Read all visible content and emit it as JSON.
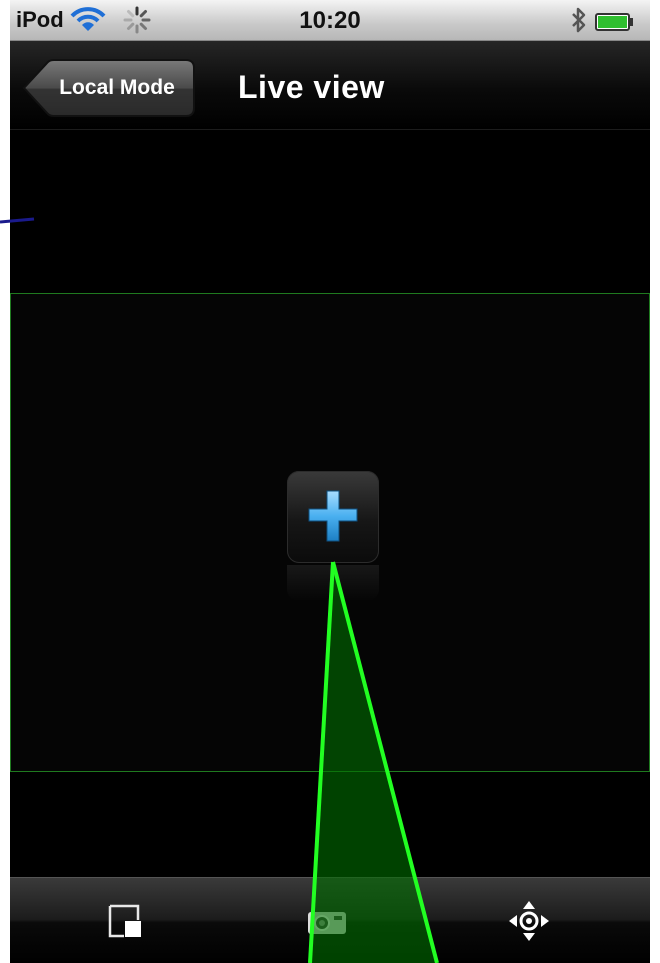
{
  "status_bar": {
    "carrier": "iPod",
    "time": "10:20",
    "icons": [
      "wifi-icon",
      "activity-spinner-icon",
      "bluetooth-icon",
      "battery-icon"
    ]
  },
  "nav_bar": {
    "back_label": "Local Mode",
    "title": "Live view"
  },
  "video": {
    "add_button_icon": "plus-icon",
    "border_color": "#1f7a1f"
  },
  "toolbar": {
    "items": [
      {
        "icon": "layout-icon"
      },
      {
        "icon": "camera-snapshot-icon"
      },
      {
        "icon": "ptz-direction-icon"
      }
    ]
  },
  "colors": {
    "accent_blue": "#3ea3e6",
    "annotation_green": "#22ff22",
    "annotation_navy": "#1a1a8c"
  }
}
